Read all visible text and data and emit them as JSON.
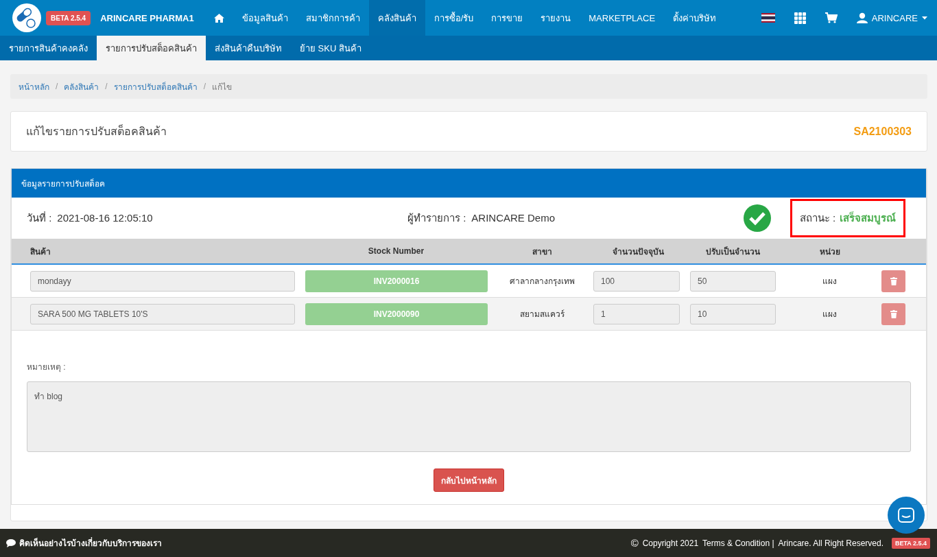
{
  "navbar": {
    "badge": "BETA 2.5.4",
    "brand": "ARINCARE PHARMA1",
    "menu": [
      {
        "kind": "home",
        "selected": false
      },
      {
        "kind": "text",
        "label": "ข้อมูลสินค้า",
        "selected": false
      },
      {
        "kind": "text",
        "label": "สมาชิกการค้า",
        "selected": false
      },
      {
        "kind": "text",
        "label": "คลังสินค้า",
        "selected": true
      },
      {
        "kind": "text",
        "label": "การซื้อ/รับ",
        "selected": false
      },
      {
        "kind": "text",
        "label": "การขาย",
        "selected": false
      },
      {
        "kind": "text",
        "label": "รายงาน",
        "selected": false
      },
      {
        "kind": "text",
        "label": "MARKETPLACE",
        "selected": false
      },
      {
        "kind": "text",
        "label": "ตั้งค่าบริษัท",
        "selected": false
      }
    ],
    "user": "ARINCARE"
  },
  "subnav": [
    {
      "label": "รายการสินค้าคงคลัง",
      "selected": false
    },
    {
      "label": "รายการปรับสต็อคสินค้า",
      "selected": true
    },
    {
      "label": "ส่งสินค้าคืนบริษัท",
      "selected": false
    },
    {
      "label": "ย้าย SKU สินค้า",
      "selected": false
    }
  ],
  "breadcrumb_separator": "/",
  "breadcrumb": [
    "หน้าหลัก",
    "คลังสินค้า",
    "รายการปรับสต็อคสินค้า",
    "แก้ไข"
  ],
  "page_title": "แก้ไขรายการปรับสต็อคสินค้า",
  "doc_number": "SA2100303",
  "panel": {
    "title": "ข้อมูลรายการปรับสต็อค",
    "date_label": "วันที่ :",
    "date": "2021-08-16 12:05:10",
    "maker_label": "ผู้ทำรายการ :",
    "maker": "ARINCARE Demo",
    "completed": true,
    "status_label": "สถานะ :",
    "status": "เสร็จสมบูรณ์",
    "status_highlighted": true,
    "table": {
      "columns": [
        "สินค้า",
        "Stock Number",
        "สาขา",
        "จำนวนปัจจุบัน",
        "ปรับเป็นจำนวน",
        "หน่วย"
      ],
      "rows": [
        {
          "product": "mondayy",
          "stock_number": "INV2000016",
          "branch": "ศาลากลางกรุงเทพ",
          "current_qty": "100",
          "adjust_qty": "50",
          "unit": "แผง"
        },
        {
          "product": "SARA 500 MG TABLETS 10'S",
          "stock_number": "INV2000090",
          "branch": "สยามสแควร์",
          "current_qty": "1",
          "adjust_qty": "10",
          "unit": "แผง"
        }
      ]
    },
    "notes_label": "หมายเหตุ :",
    "notes": "ทำ blog",
    "back_button": "กลับไปหน้าหลัก"
  },
  "footer": {
    "feedback": "คิดเห็นอย่างไรบ้างเกี่ยวกับบริการของเรา",
    "copyright_symbol": "©",
    "copyright": "Copyright 2021",
    "terms": "Terms & Condition |",
    "rights": "Arincare. All Right Reserved.",
    "badge": "BETA 2.5.4"
  }
}
